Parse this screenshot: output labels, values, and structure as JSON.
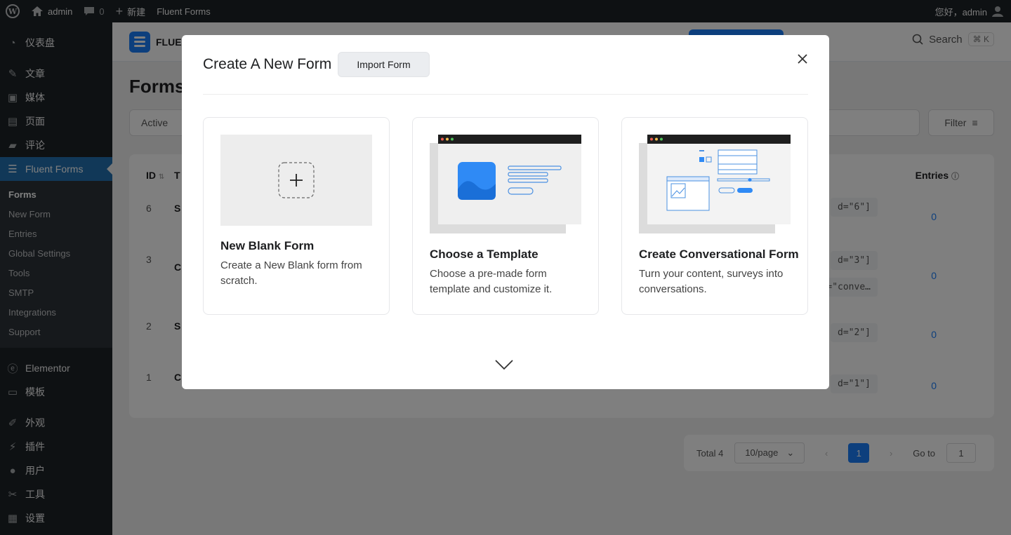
{
  "adminbar": {
    "site_name": "admin",
    "comments_count": "0",
    "new_label": "新建",
    "plugin_link": "Fluent Forms",
    "greeting": "您好，admin"
  },
  "sidebar": {
    "items": [
      {
        "label": "仪表盘",
        "icon": "dashboard-icon"
      },
      {
        "label": "文章",
        "icon": "pin-icon"
      },
      {
        "label": "媒体",
        "icon": "media-icon"
      },
      {
        "label": "页面",
        "icon": "page-icon"
      },
      {
        "label": "评论",
        "icon": "comment-icon"
      },
      {
        "label": "Fluent Forms",
        "icon": "fluent-forms-icon"
      }
    ],
    "submenu": [
      "Forms",
      "New Form",
      "Entries",
      "Global Settings",
      "Tools",
      "SMTP",
      "Integrations",
      "Support"
    ],
    "items_after": [
      {
        "label": "Elementor",
        "icon": "elementor-icon"
      },
      {
        "label": "模板",
        "icon": "folder-icon"
      },
      {
        "label": "外观",
        "icon": "brush-icon"
      },
      {
        "label": "插件",
        "icon": "plugin-icon"
      },
      {
        "label": "用户",
        "icon": "user-icon"
      },
      {
        "label": "工具",
        "icon": "wrench-icon"
      },
      {
        "label": "设置",
        "icon": "settings-icon"
      }
    ]
  },
  "page": {
    "logo_text": "FLUEN",
    "search_label": "Search",
    "search_kbd": "⌘ K",
    "title": "Forms",
    "tab_active": "Active",
    "filter_label": "Filter",
    "col_id": "ID",
    "col_title": "T",
    "col_entries": "Entries",
    "rows": [
      {
        "id": "6",
        "name": "S",
        "shortcode": "d=\"6\"]",
        "entries": "0"
      },
      {
        "id": "3",
        "name": "C",
        "shortcode": "d=\"3\"]",
        "shortcode2": "=\"conve…",
        "entries": "0"
      },
      {
        "id": "2",
        "name": "S",
        "shortcode": "d=\"2\"]",
        "entries": "0"
      },
      {
        "id": "1",
        "name": "C",
        "shortcode": "d=\"1\"]",
        "entries": "0"
      }
    ],
    "pager": {
      "total": "Total 4",
      "per_page": "10/page",
      "current": "1",
      "goto_label": "Go to",
      "goto_value": "1"
    }
  },
  "modal": {
    "title": "Create A New Form",
    "import_label": "Import Form",
    "cards": [
      {
        "title": "New Blank Form",
        "desc": "Create a New Blank form from scratch."
      },
      {
        "title": "Choose a Template",
        "desc": "Choose a pre-made form template and customize it."
      },
      {
        "title": "Create Conversational Form",
        "desc": "Turn your content, surveys into conversations."
      }
    ]
  }
}
